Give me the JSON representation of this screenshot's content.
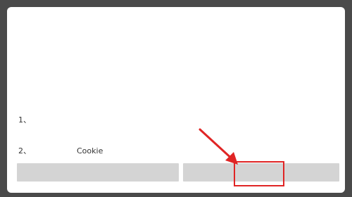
{
  "dialog": {
    "title": "",
    "paragraph": "",
    "list_items": [
      {
        "number": "1、",
        "text": ""
      },
      {
        "number": "2、",
        "text_before": "",
        "text_highlight": "Cookie",
        "text_after": ""
      }
    ],
    "buttons": {
      "refuse_label": "",
      "agree_label": ""
    }
  },
  "colors": {
    "overlay": "#4a4a4a",
    "dialog_bg": "#ffffff",
    "button_bg": "#d4d4d4",
    "annotation_red": "#e02525"
  }
}
